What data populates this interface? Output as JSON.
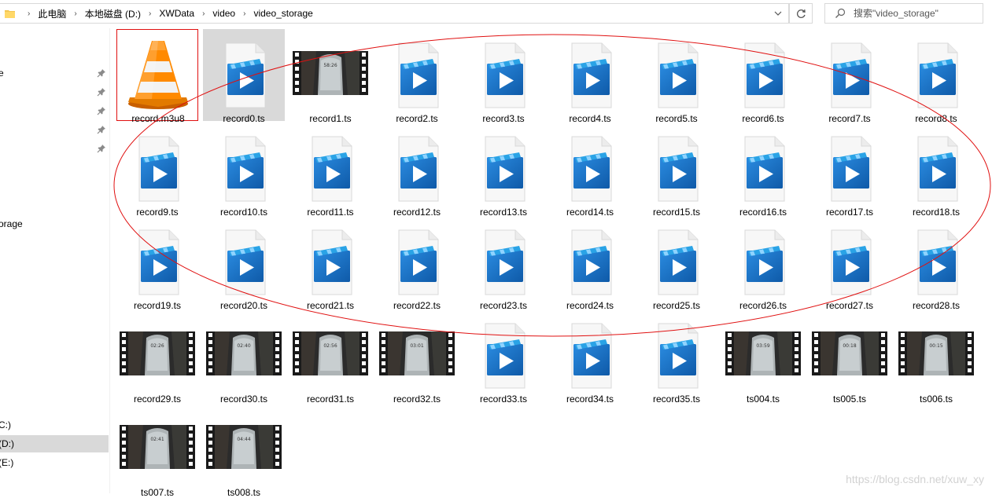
{
  "address": {
    "crumbs": [
      "此电脑",
      "本地磁盘 (D:)",
      "XWData",
      "video",
      "video_storage"
    ]
  },
  "search": {
    "placeholder": "搜索\"video_storage\""
  },
  "nav": {
    "items": [
      {
        "label": "e",
        "pinned": true
      },
      {
        "label": "",
        "pinned": true
      },
      {
        "label": "",
        "pinned": true
      },
      {
        "label": "",
        "pinned": true
      },
      {
        "label": "",
        "pinned": true
      },
      {
        "label": "orage",
        "pinned": false
      },
      {
        "label": "C:)",
        "pinned": false
      },
      {
        "label": "(D:)",
        "pinned": false,
        "selected": true
      },
      {
        "label": "(E:)",
        "pinned": false
      }
    ]
  },
  "files": [
    {
      "name": "record.m3u8",
      "type": "vlc",
      "highlight": "red"
    },
    {
      "name": "record0.ts",
      "type": "video",
      "highlight": "selected"
    },
    {
      "name": "record1.ts",
      "type": "thumb",
      "time": "58:26"
    },
    {
      "name": "record2.ts",
      "type": "video"
    },
    {
      "name": "record3.ts",
      "type": "video"
    },
    {
      "name": "record4.ts",
      "type": "video"
    },
    {
      "name": "record5.ts",
      "type": "video"
    },
    {
      "name": "record6.ts",
      "type": "video"
    },
    {
      "name": "record7.ts",
      "type": "video"
    },
    {
      "name": "record8.ts",
      "type": "video"
    },
    {
      "name": "record9.ts",
      "type": "video"
    },
    {
      "name": "record10.ts",
      "type": "video"
    },
    {
      "name": "record11.ts",
      "type": "video"
    },
    {
      "name": "record12.ts",
      "type": "video"
    },
    {
      "name": "record13.ts",
      "type": "video"
    },
    {
      "name": "record14.ts",
      "type": "video"
    },
    {
      "name": "record15.ts",
      "type": "video"
    },
    {
      "name": "record16.ts",
      "type": "video"
    },
    {
      "name": "record17.ts",
      "type": "video"
    },
    {
      "name": "record18.ts",
      "type": "video"
    },
    {
      "name": "record19.ts",
      "type": "video"
    },
    {
      "name": "record20.ts",
      "type": "video"
    },
    {
      "name": "record21.ts",
      "type": "video"
    },
    {
      "name": "record22.ts",
      "type": "video"
    },
    {
      "name": "record23.ts",
      "type": "video"
    },
    {
      "name": "record24.ts",
      "type": "video"
    },
    {
      "name": "record25.ts",
      "type": "video"
    },
    {
      "name": "record26.ts",
      "type": "video"
    },
    {
      "name": "record27.ts",
      "type": "video"
    },
    {
      "name": "record28.ts",
      "type": "video"
    },
    {
      "name": "record29.ts",
      "type": "thumb",
      "time": "02:26"
    },
    {
      "name": "record30.ts",
      "type": "thumb",
      "time": "02:40"
    },
    {
      "name": "record31.ts",
      "type": "thumb",
      "time": "02:56"
    },
    {
      "name": "record32.ts",
      "type": "thumb",
      "time": "03:01"
    },
    {
      "name": "record33.ts",
      "type": "video"
    },
    {
      "name": "record34.ts",
      "type": "video"
    },
    {
      "name": "record35.ts",
      "type": "video"
    },
    {
      "name": "ts004.ts",
      "type": "thumb",
      "time": "03:59"
    },
    {
      "name": "ts005.ts",
      "type": "thumb",
      "time": "00:18"
    },
    {
      "name": "ts006.ts",
      "type": "thumb",
      "time": "00:15"
    },
    {
      "name": "ts007.ts",
      "type": "thumb",
      "time": "02:41"
    },
    {
      "name": "ts008.ts",
      "type": "thumb",
      "time": "04:44"
    }
  ],
  "watermark": "https://blog.csdn.net/xuw_xy",
  "colors": {
    "annotation_red": "#e01010",
    "selected_bg": "#d9d9d9",
    "video_blue": "#1e78d2"
  },
  "icons": {
    "folder": "folder-icon",
    "chevron": "chevron-right-icon",
    "dropdown": "chevron-down-icon",
    "refresh": "refresh-icon",
    "search": "search-icon",
    "pin": "pin-icon",
    "video_file": "video-file-icon",
    "vlc": "vlc-cone-icon",
    "thumbnail": "video-thumbnail-icon"
  }
}
